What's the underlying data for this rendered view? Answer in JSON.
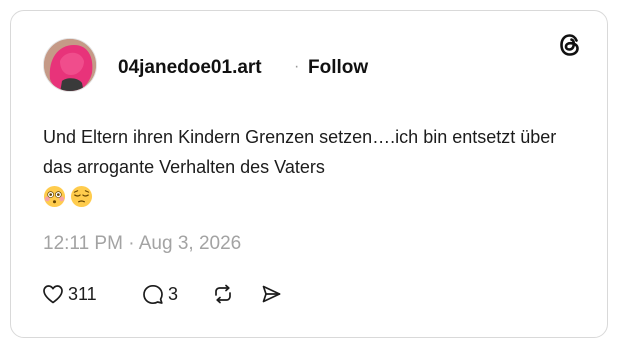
{
  "post": {
    "username": "04janedoe01.art",
    "separator": "·",
    "follow_label": "Follow",
    "text": "Und Eltern ihren Kindern Grenzen setzen….ich bin entsetzt über das arrogante Verhalten des Vaters",
    "emojis": [
      "flushed-face",
      "pensive-face"
    ],
    "timestamp": "12:11 PM · Aug 3, 2026",
    "likes": "311",
    "replies": "3"
  },
  "icons": {
    "brand": "threads-logo",
    "like": "heart-icon",
    "reply": "comment-icon",
    "repost": "repost-icon",
    "share": "share-icon"
  },
  "colors": {
    "text": "#1c1c1c",
    "muted": "#a3a3a3",
    "border": "#d9d9d9"
  }
}
